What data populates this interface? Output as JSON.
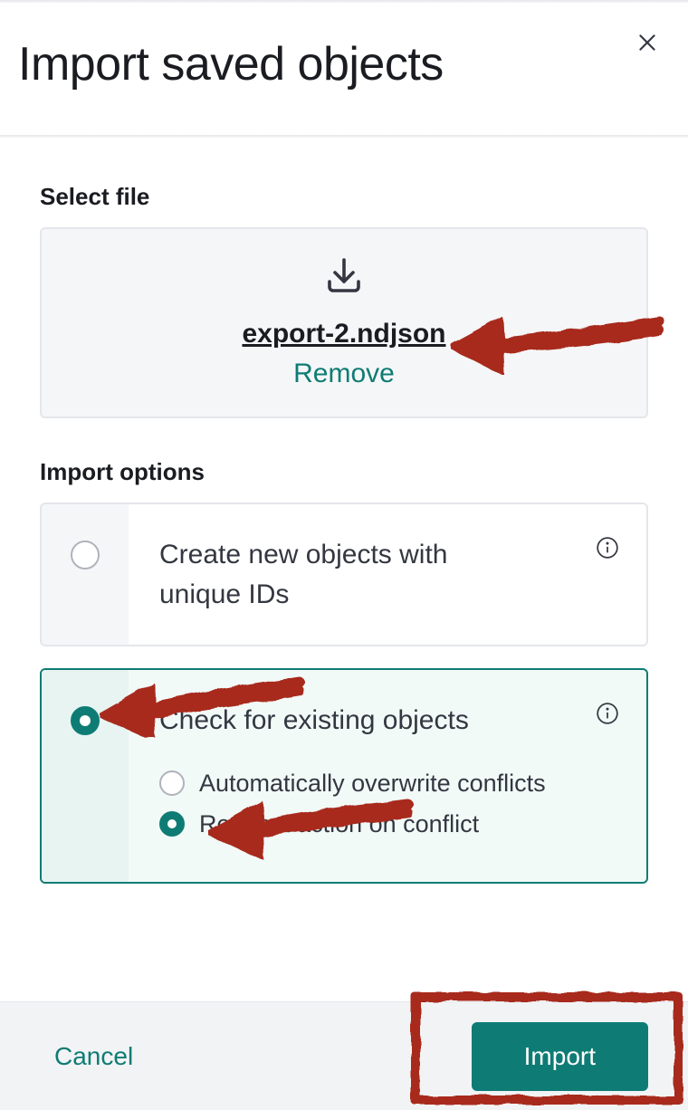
{
  "header": {
    "title": "Import saved objects"
  },
  "file_section": {
    "label": "Select file",
    "file_name": "export-2.ndjson",
    "remove_label": "Remove"
  },
  "options_section": {
    "label": "Import options",
    "options": [
      {
        "title": "Create new objects with unique IDs",
        "selected": false
      },
      {
        "title": "Check for existing objects",
        "selected": true,
        "sub_options": [
          {
            "label": "Automatically overwrite conflicts",
            "selected": false
          },
          {
            "label": "Request action on conflict",
            "selected": true
          }
        ]
      }
    ]
  },
  "footer": {
    "cancel": "Cancel",
    "import": "Import"
  }
}
